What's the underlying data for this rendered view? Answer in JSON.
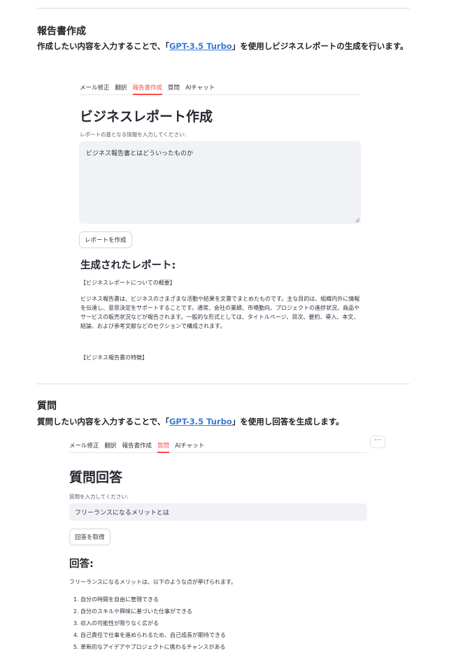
{
  "report_section": {
    "title": "報告書作成",
    "desc_prefix": "作成したい内容を入力することで、「",
    "link": "GPT-3.5 Turbo",
    "desc_suffix": "」を使用しビジネスレポートの生成を行います。",
    "tabs": [
      {
        "label": "メール修正"
      },
      {
        "label": "翻訳"
      },
      {
        "label": "報告書作成"
      },
      {
        "label": "質問"
      },
      {
        "label": "AIチャット"
      }
    ],
    "active_tab": "報告書作成",
    "heading": "ビジネスレポート作成",
    "input_label": "レポートの基となる情報を入力してください:",
    "input_value": "ビジネス報告書とはどういったものか",
    "button_label": "レポートを作成",
    "result_heading": "生成されたレポート:",
    "result_line1": "【ビジネスレポートについての概要】",
    "result_paragraph": "ビジネス報告書は、ビジネスのさまざまな活動や結果を文書でまとめたものです。主な目的は、組織内外に情報を伝達し、意思決定をサポートすることです。通常、会社の業績、市場動向、プロジェクトの進捗状況、商品やサービスの販売状況などが報告されます。一般的な形式としては、タイトルページ、目次、要約、導入、本文、結論、および参考文献などのセクションで構成されます。",
    "result_line2": "【ビジネス報告書の特徴】"
  },
  "question_section": {
    "title": "質問",
    "desc_prefix": "質問したい内容を入力することで、「",
    "link": "GPT-3.5 Turbo",
    "desc_suffix": "」を使用し回答を生成します。",
    "tabs": [
      {
        "label": "メール修正"
      },
      {
        "label": "翻訳"
      },
      {
        "label": "報告書作成"
      },
      {
        "label": "質問"
      },
      {
        "label": "AIチャット"
      }
    ],
    "active_tab": "質問",
    "menu_label": "⋯",
    "heading": "質問回答",
    "input_label": "質問を入力してください:",
    "input_value": "フリーランスになるメリットとは",
    "button_label": "回答を取得",
    "answer_heading": "回答:",
    "answer_intro": "フリーランスになるメリットは、以下のような点が挙げられます。",
    "answer_items": [
      "自分の時間を自由に管理できる",
      "自分のスキルや興味に基づいた仕事ができる",
      "収入の可能性が限りなく広がる",
      "自己責任で仕事を進められるため、自己成長が期待できる",
      "革新的なアイデアやプロジェクトに携わるチャンスがある"
    ]
  }
}
